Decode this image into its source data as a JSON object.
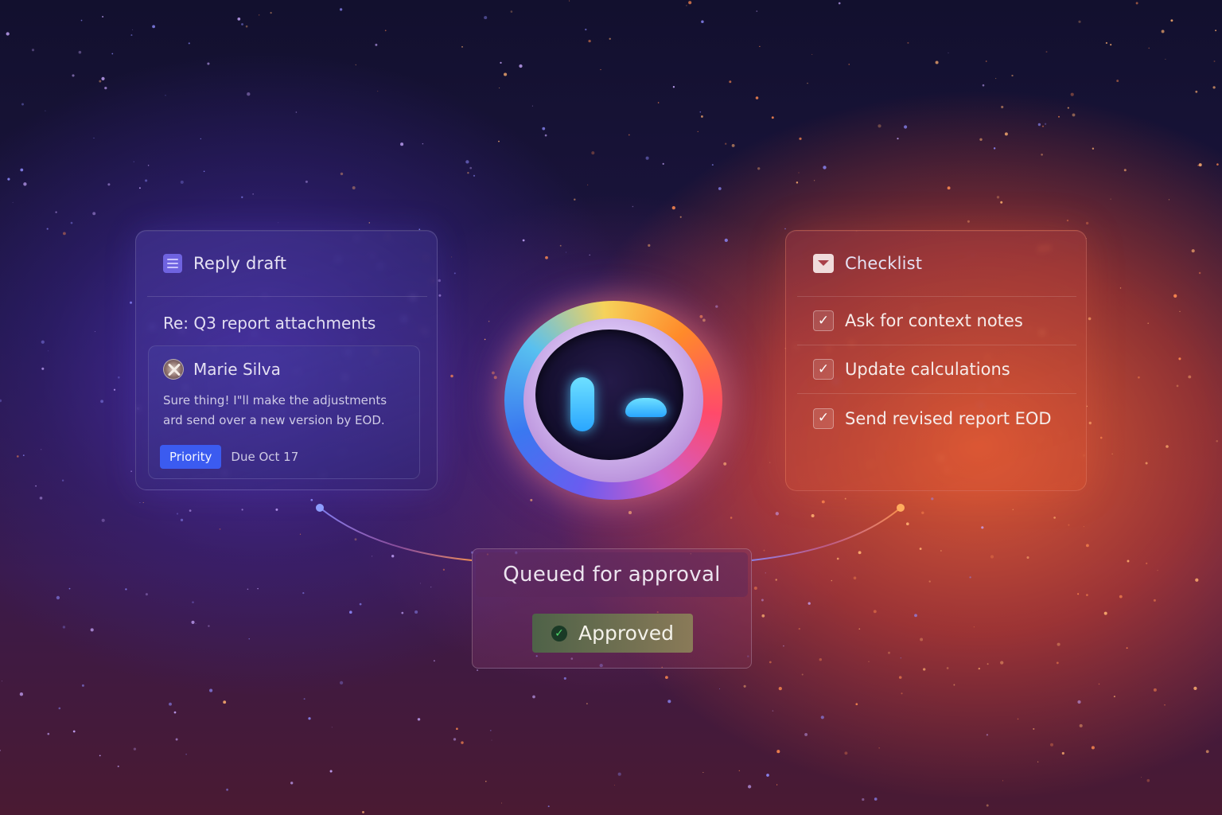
{
  "reply_draft": {
    "title": "Reply draft",
    "icon": "document-icon",
    "subject": "Re: Q3 report attachments",
    "message": {
      "sender": "Marie Silva",
      "body": "Sure thing! I\"ll make the adjustments ard send over a new version by EOD.",
      "priority_label": "Priority",
      "due": "Due Oct 17"
    }
  },
  "checklist": {
    "title": "Checklist",
    "icon": "inbox-icon",
    "items": [
      {
        "label": "Ask for context notes",
        "checked": true
      },
      {
        "label": "Update calculations",
        "checked": true
      },
      {
        "label": "Send revised report EOD",
        "checked": true
      }
    ]
  },
  "approval": {
    "status": "Queued for approval",
    "button_label": "Approved",
    "button_icon": "check-circle-icon"
  },
  "colors": {
    "accent_blue": "#3b5bf0",
    "accent_orange": "#ff6a30",
    "approved_green": "#4ed86a"
  }
}
